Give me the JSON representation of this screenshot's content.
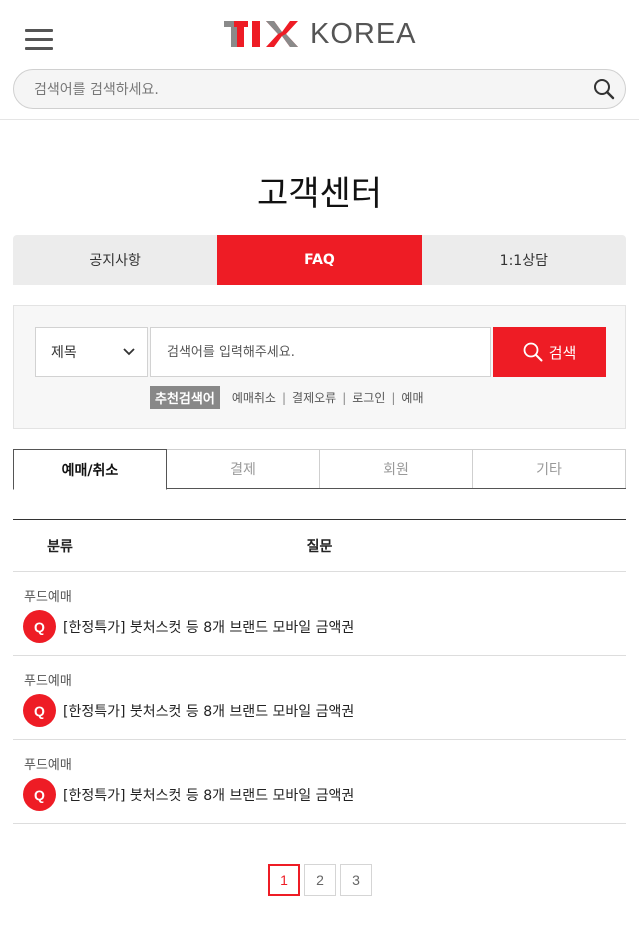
{
  "header": {
    "logo_text": "KOREA",
    "search_placeholder": "검색어를 검색하세요."
  },
  "page_title": "고객센터",
  "main_tabs": [
    {
      "label": "공지사항",
      "active": false
    },
    {
      "label": "FAQ",
      "active": true
    },
    {
      "label": "1:1상담",
      "active": false
    }
  ],
  "faq_search": {
    "select_value": "제목",
    "input_placeholder": "검색어를 입력해주세요.",
    "button_label": "검색",
    "keywords_label": "추천검색어",
    "keywords": [
      "예매취소",
      "결제오류",
      "로그인",
      "예매"
    ]
  },
  "category_tabs": [
    {
      "label": "예매/취소",
      "active": true
    },
    {
      "label": "결제",
      "active": false
    },
    {
      "label": "회원",
      "active": false
    },
    {
      "label": "기타",
      "active": false
    }
  ],
  "table": {
    "headers": {
      "category": "분류",
      "question": "질문"
    },
    "badge": "Q",
    "rows": [
      {
        "category": "푸드예매",
        "question": "[한정특가] 붓처스컷 등 8개 브랜드 모바일 금액권"
      },
      {
        "category": "푸드예매",
        "question": "[한정특가] 붓처스컷 등 8개 브랜드 모바일 금액권"
      },
      {
        "category": "푸드예매",
        "question": "[한정특가] 붓처스컷 등 8개 브랜드 모바일 금액권"
      }
    ]
  },
  "pagination": {
    "pages": [
      "1",
      "2",
      "3"
    ],
    "current": "1"
  },
  "colors": {
    "accent": "#ee1c25",
    "logo_gray": "#555555"
  }
}
